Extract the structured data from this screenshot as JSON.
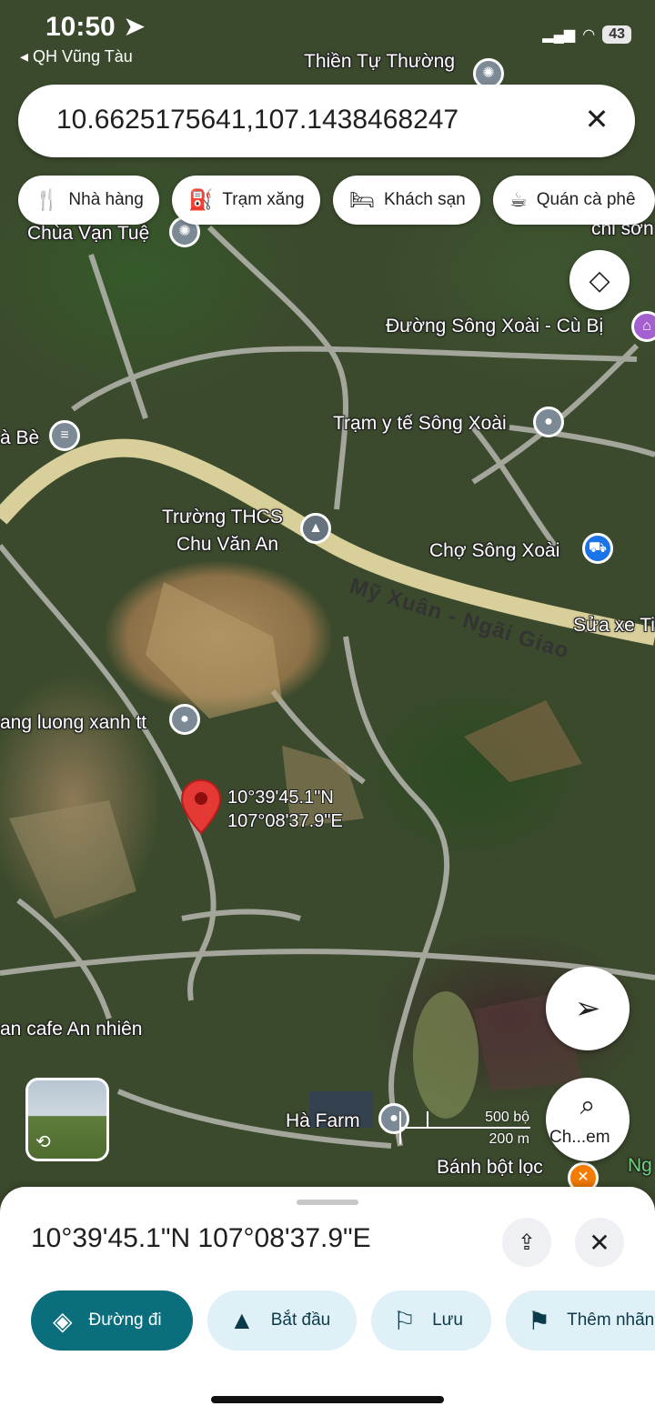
{
  "status_bar": {
    "time": "10:50",
    "back_app": "◂ QH Vũng Tàu",
    "battery": "43"
  },
  "search": {
    "value": "10.6625175641,107.1438468247"
  },
  "chips": [
    {
      "label": "Nhà hàng",
      "icon": "restaurant-icon"
    },
    {
      "label": "Trạm xăng",
      "icon": "gas-station-icon"
    },
    {
      "label": "Khách sạn",
      "icon": "hotel-icon"
    },
    {
      "label": "Quán cà phê",
      "icon": "cafe-icon"
    }
  ],
  "map": {
    "labels": {
      "thien_tu": "Thiền Tự Thường",
      "chi_son": "chi sơn",
      "chua_van_tue": "Chùa Vạn Tuệ",
      "duong_song_xoai": "Đường Sông Xoài - Cù Bị",
      "ha_be": "à Bè",
      "tram_y_te": "Trạm y tế Sông Xoài",
      "truong_thcs": "Trường THCS",
      "chu_van_an": "Chu Văn An",
      "cho_song_xoai": "Chợ Sông Xoài",
      "road_my_xuan": "Mỹ Xuân - Ngãi Giao",
      "sua_xe": "Sửa xe Ti",
      "nang_luong": "ang luong xanh tt",
      "cafe_an_nhien": "an cafe An nhiên",
      "ha_farm": "Hà Farm",
      "banh_bot_loc": "Bánh bột lọc",
      "ng": "Ng"
    },
    "dropped_pin": {
      "lat": "10°39'45.1\"N",
      "lng": "107°08'37.9\"E"
    },
    "scale": {
      "feet": "500 bộ",
      "meters": "200 m"
    },
    "lens_label": "Ch...em"
  },
  "sheet": {
    "title": "10°39'45.1\"N 107°08'37.9\"E",
    "actions": [
      {
        "label": "Đường đi",
        "icon": "directions-icon"
      },
      {
        "label": "Bắt đầu",
        "icon": "navigation-icon"
      },
      {
        "label": "Lưu",
        "icon": "bookmark-icon"
      },
      {
        "label": "Thêm nhãn",
        "icon": "flag-icon"
      }
    ]
  },
  "colors": {
    "accent": "#0b6e7c",
    "pin_red": "#e53935",
    "chip_bg": "#ffffff"
  }
}
